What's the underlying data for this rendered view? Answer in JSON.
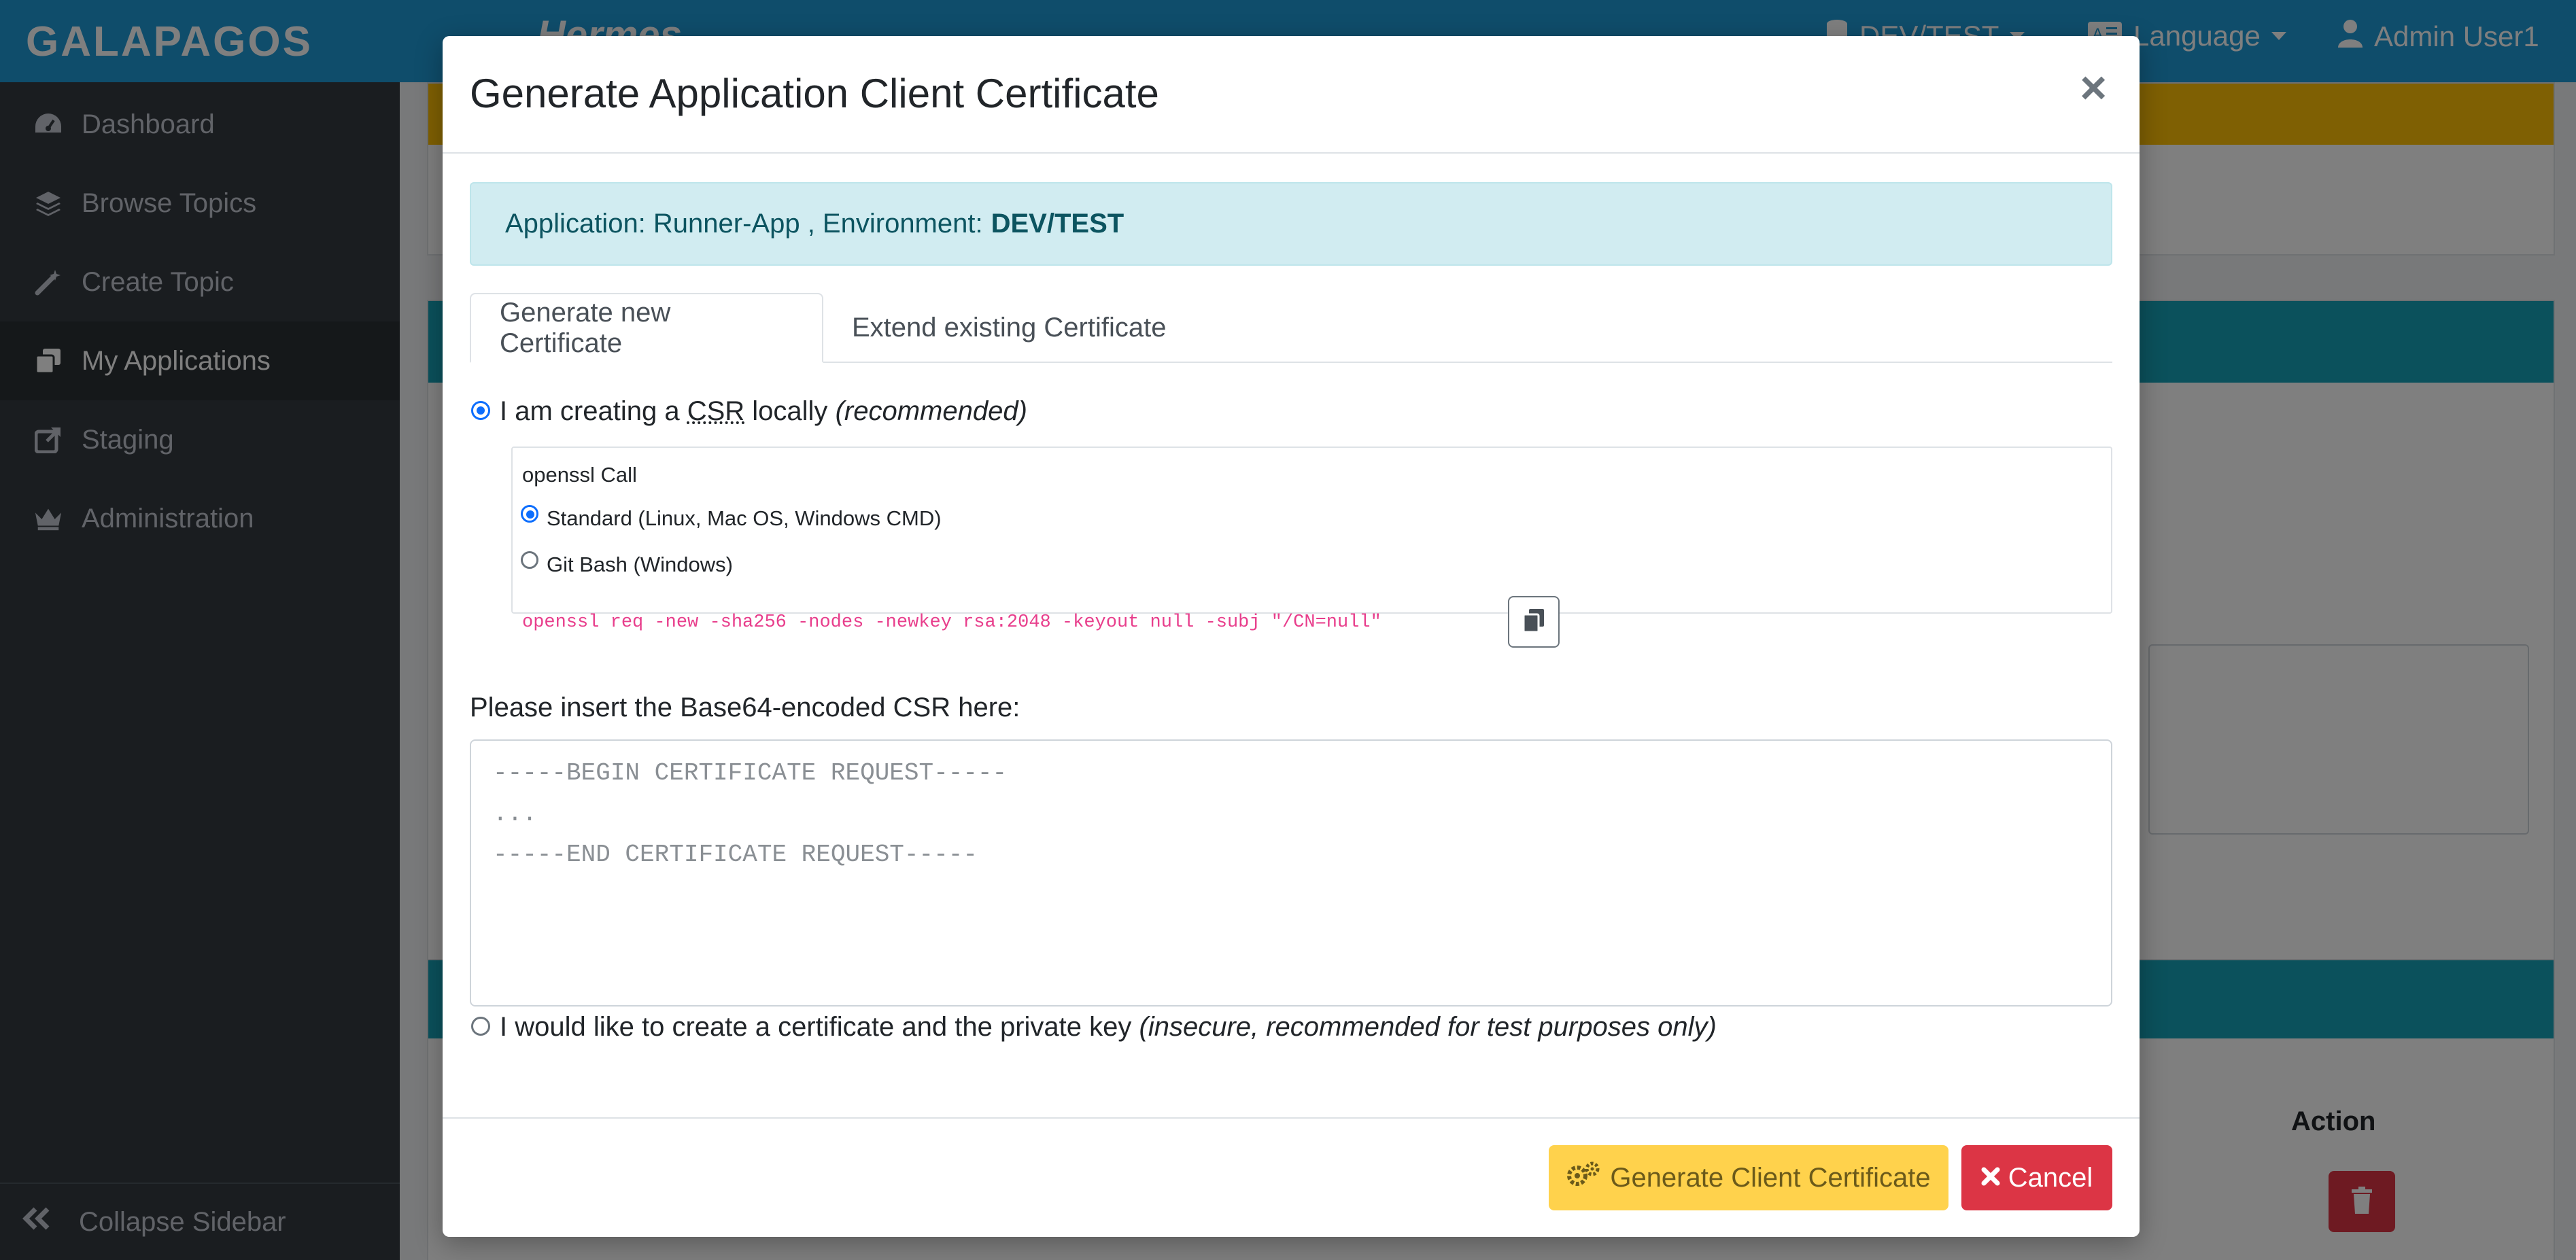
{
  "topbar": {
    "brand": "GALAPAGOS",
    "product": "Hermes",
    "environment": "DEV/TEST",
    "language": "Language",
    "user": "Admin User1"
  },
  "sidebar": {
    "items": [
      {
        "label": "Dashboard",
        "icon": "dashboard-icon"
      },
      {
        "label": "Browse Topics",
        "icon": "layers-icon"
      },
      {
        "label": "Create Topic",
        "icon": "magic-wand-icon"
      },
      {
        "label": "My Applications",
        "icon": "applications-icon"
      },
      {
        "label": "Staging",
        "icon": "external-link-icon"
      },
      {
        "label": "Administration",
        "icon": "crown-icon"
      }
    ],
    "active": "My Applications",
    "collapse_label": "Collapse Sidebar"
  },
  "background": {
    "action_header": "Action"
  },
  "modal": {
    "title": "Generate Application Client Certificate",
    "close": "×",
    "info": {
      "app_text": "Application: Runner-App , Environment:",
      "env_value": "DEV/TEST"
    },
    "tabs": [
      {
        "label": "Generate new Certificate",
        "active": true
      },
      {
        "label": "Extend existing Certificate",
        "active": false
      }
    ],
    "option_csr": {
      "prefix": "I am creating a",
      "abbr": "CSR",
      "suffix": "locally",
      "note": "(recommended)",
      "checked": true
    },
    "openssl": {
      "title": "openssl Call",
      "standard_label": "Standard (Linux, Mac OS, Windows CMD)",
      "gitbash_label": "Git Bash (Windows)",
      "selected": "Standard (Linux, Mac OS, Windows CMD)",
      "command": "openssl req -new -sha256 -nodes -newkey rsa:2048 -keyout null -subj \"/CN=null\""
    },
    "insert_label": "Please insert the Base64-encoded CSR here:",
    "csr_placeholder": "-----BEGIN CERTIFICATE REQUEST-----\n...\n-----END CERTIFICATE REQUEST-----",
    "option_key": {
      "text": "I would like to create a certificate and the private key",
      "note": "(insecure, recommended for test purposes only)",
      "checked": false
    },
    "buttons": {
      "generate": "Generate Client Certificate",
      "cancel": "Cancel"
    }
  },
  "colors": {
    "topbar": "#1e9bd7",
    "sidebar": "#343a40",
    "alert_bg": "#d1ecf1",
    "generate_button": "#ffd24c",
    "cancel_button": "#dc3545",
    "code_text": "#e83e8c"
  }
}
